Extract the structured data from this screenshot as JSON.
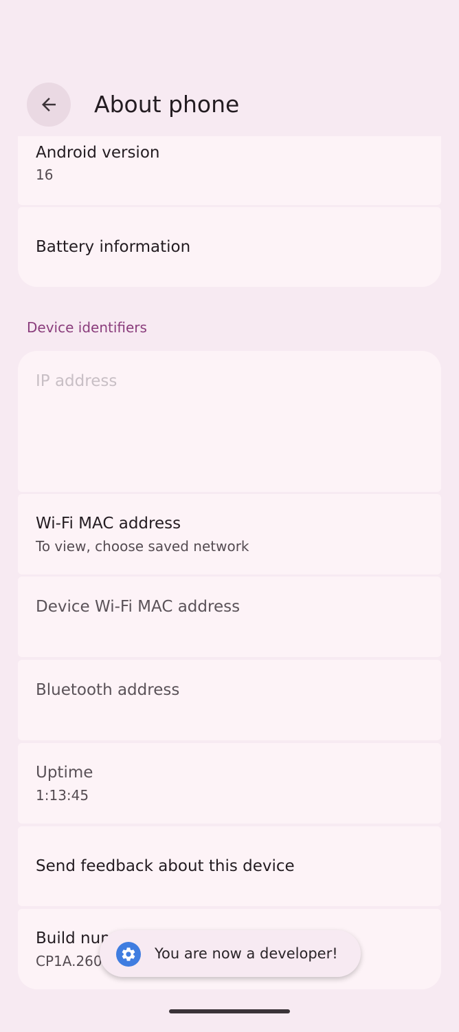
{
  "header": {
    "title": "About phone",
    "back_icon": "arrow-left-icon"
  },
  "rows_top": [
    {
      "title": "Android version",
      "subtitle": "16"
    },
    {
      "title": "Battery information"
    }
  ],
  "section": {
    "label": "Device identifiers"
  },
  "rows_identifiers": [
    {
      "title": "IP address"
    },
    {
      "title": "Wi-Fi MAC address",
      "subtitle": "To view, choose saved network"
    },
    {
      "title": "Device Wi-Fi MAC address"
    },
    {
      "title": "Bluetooth address"
    },
    {
      "title": "Uptime",
      "subtitle": "1:13:45"
    },
    {
      "title": "Send feedback about this device"
    },
    {
      "title": "Build number",
      "subtitle": "CP1A.260"
    }
  ],
  "toast": {
    "text": "You are now a developer!",
    "icon": "gear-icon",
    "icon_color": "#3f7de0"
  },
  "colors": {
    "background": "#f7eaf2",
    "card": "#fdf3f7",
    "accent": "#8a3d7c"
  }
}
